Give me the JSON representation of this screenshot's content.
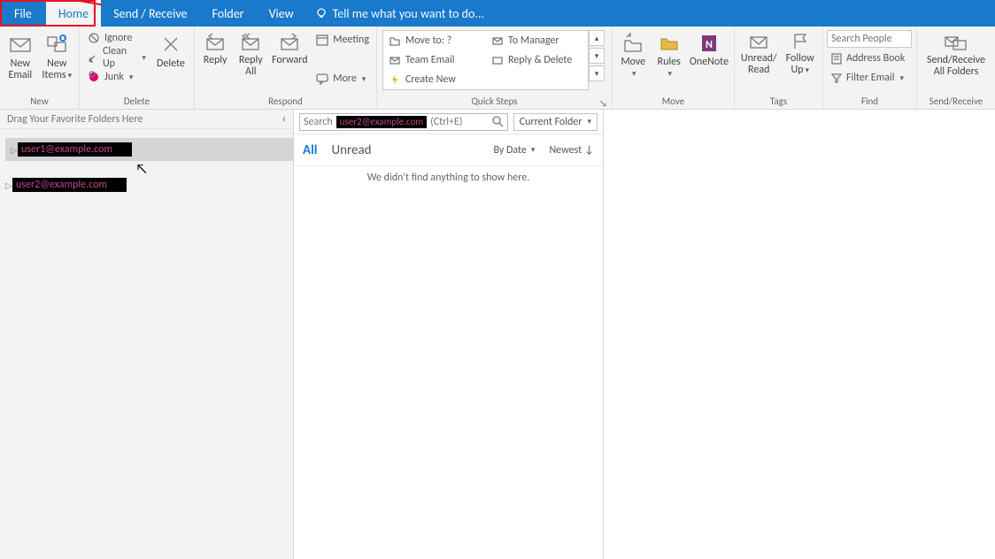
{
  "tabs": {
    "file": "File",
    "home": "Home",
    "send_receive": "Send / Receive",
    "folder": "Folder",
    "view": "View",
    "tell_me": "Tell me what you want to do..."
  },
  "ribbon": {
    "new": {
      "label": "New",
      "new_email": "New\nEmail",
      "new_items": "New\nItems"
    },
    "delete": {
      "label": "Delete",
      "ignore": "Ignore",
      "clean_up": "Clean Up",
      "junk": "Junk",
      "delete_btn": "Delete"
    },
    "respond": {
      "label": "Respond",
      "reply": "Reply",
      "reply_all": "Reply\nAll",
      "forward": "Forward",
      "meeting": "Meeting",
      "more": "More"
    },
    "quick_steps": {
      "label": "Quick Steps",
      "move_to": "Move to: ?",
      "to_manager": "To Manager",
      "team_email": "Team Email",
      "reply_delete": "Reply & Delete",
      "create_new": "Create New"
    },
    "move": {
      "label": "Move",
      "move_btn": "Move",
      "rules": "Rules",
      "onenote": "OneNote"
    },
    "tags": {
      "label": "Tags",
      "unread_read": "Unread/\nRead",
      "follow_up": "Follow\nUp"
    },
    "find": {
      "label": "Find",
      "search_placeholder": "Search People",
      "address_book": "Address Book",
      "filter_email": "Filter Email"
    },
    "send_receive": {
      "label": "Send/Receive",
      "btn": "Send/Receive\nAll Folders"
    }
  },
  "nav": {
    "drag_hint": "Drag Your Favorite Folders Here",
    "account1": "user1@example.com",
    "account2": "user2@example.com"
  },
  "list": {
    "search_prefix": "Search",
    "search_redacted": "user2@example.com",
    "search_shortcut": "(Ctrl+E)",
    "scope": "Current Folder",
    "filter_all": "All",
    "filter_unread": "Unread",
    "sort_by": "By Date",
    "sort_order": "Newest",
    "empty": "We didn't find anything to show here."
  }
}
